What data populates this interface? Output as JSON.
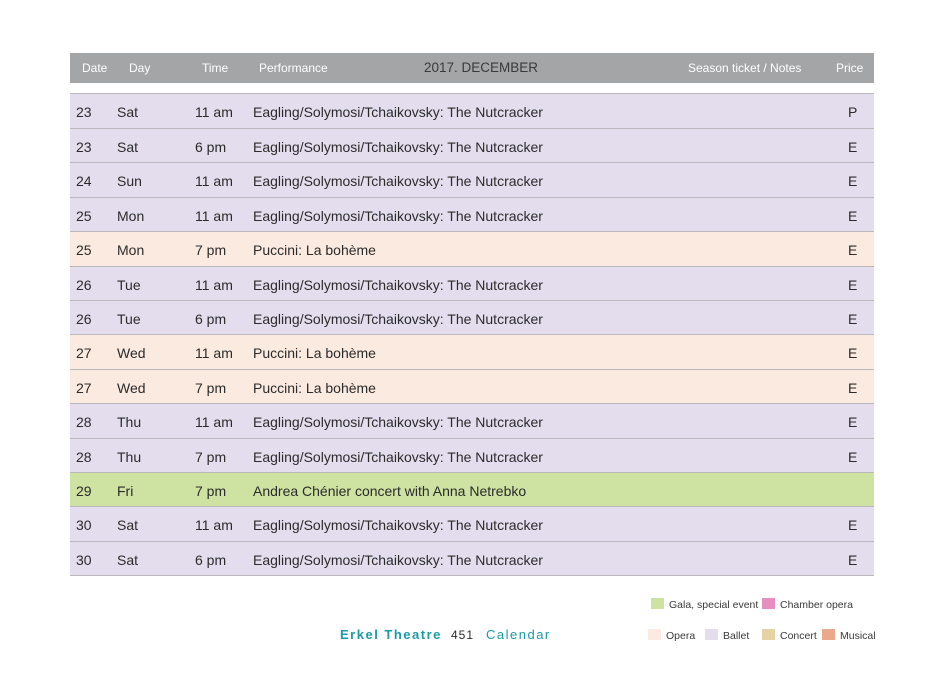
{
  "header": {
    "date": "Date",
    "day": "Day",
    "time": "Time",
    "performance": "Performance",
    "month": "2017. DECEMBER",
    "notes": "Season ticket / Notes",
    "price": "Price"
  },
  "rows": [
    {
      "date": "23",
      "day": "Sat",
      "time": "11 am",
      "performance": "Eagling/Solymosi/Tchaikovsky: The Nutcracker",
      "price": "P",
      "category": "ballet"
    },
    {
      "date": "23",
      "day": "Sat",
      "time": "6 pm",
      "performance": "Eagling/Solymosi/Tchaikovsky: The Nutcracker",
      "price": "E",
      "category": "ballet"
    },
    {
      "date": "24",
      "day": "Sun",
      "time": "11 am",
      "performance": "Eagling/Solymosi/Tchaikovsky: The Nutcracker",
      "price": "E",
      "category": "ballet"
    },
    {
      "date": "25",
      "day": "Mon",
      "time": "11 am",
      "performance": "Eagling/Solymosi/Tchaikovsky: The Nutcracker",
      "price": "E",
      "category": "ballet"
    },
    {
      "date": "25",
      "day": "Mon",
      "time": "7 pm",
      "performance": "Puccini: La bohème",
      "price": "E",
      "category": "opera"
    },
    {
      "date": "26",
      "day": "Tue",
      "time": "11 am",
      "performance": "Eagling/Solymosi/Tchaikovsky: The Nutcracker",
      "price": "E",
      "category": "ballet"
    },
    {
      "date": "26",
      "day": "Tue",
      "time": "6 pm",
      "performance": "Eagling/Solymosi/Tchaikovsky: The Nutcracker",
      "price": "E",
      "category": "ballet"
    },
    {
      "date": "27",
      "day": "Wed",
      "time": "11 am",
      "performance": "Puccini: La bohème",
      "price": "E",
      "category": "opera"
    },
    {
      "date": "27",
      "day": "Wed",
      "time": "7 pm",
      "performance": "Puccini: La bohème",
      "price": "E",
      "category": "opera"
    },
    {
      "date": "28",
      "day": "Thu",
      "time": "11 am",
      "performance": "Eagling/Solymosi/Tchaikovsky: The Nutcracker",
      "price": "E",
      "category": "ballet"
    },
    {
      "date": "28",
      "day": "Thu",
      "time": "7 pm",
      "performance": "Eagling/Solymosi/Tchaikovsky: The Nutcracker",
      "price": "E",
      "category": "ballet"
    },
    {
      "date": "29",
      "day": "Fri",
      "time": "7 pm",
      "performance": "Andrea Chénier concert with Anna Netrebko",
      "price": "",
      "category": "gala"
    },
    {
      "date": "30",
      "day": "Sat",
      "time": "11 am",
      "performance": "Eagling/Solymosi/Tchaikovsky: The Nutcracker",
      "price": "E",
      "category": "ballet"
    },
    {
      "date": "30",
      "day": "Sat",
      "time": "6 pm",
      "performance": "Eagling/Solymosi/Tchaikovsky: The Nutcracker",
      "price": "E",
      "category": "ballet"
    }
  ],
  "legend": {
    "gala": {
      "label": "Gala, special event",
      "color": "#cee2a1"
    },
    "chamber": {
      "label": "Chamber opera",
      "color": "#e78fbf"
    },
    "opera": {
      "label": "Opera",
      "color": "#fbeadf"
    },
    "ballet": {
      "label": "Ballet",
      "color": "#e3ddee"
    },
    "concert": {
      "label": "Concert",
      "color": "#e6d3a3"
    },
    "musical": {
      "label": "Musical",
      "color": "#e9a98a"
    }
  },
  "footer": {
    "theatre": "Erkel Theatre",
    "page": "451",
    "section": "Calendar"
  }
}
